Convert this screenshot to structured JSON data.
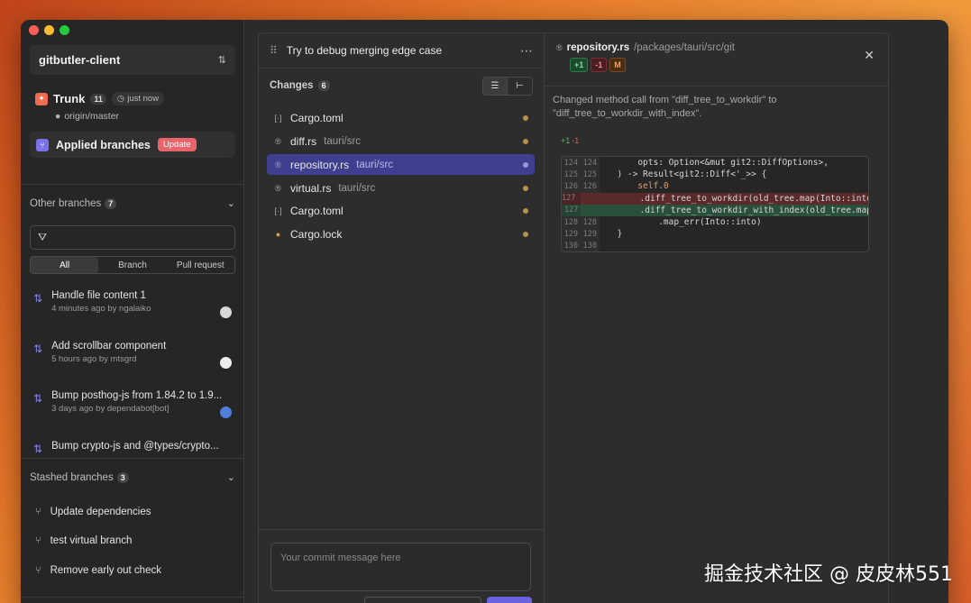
{
  "sidebar": {
    "project": "gitbutler-client",
    "trunk": {
      "title": "Trunk",
      "count": "11",
      "time": "just now",
      "remote": "origin/master"
    },
    "applied": {
      "title": "Applied branches",
      "badge": "Update"
    },
    "other": {
      "label": "Other branches",
      "count": "7",
      "filter_placeholder": "",
      "tabs": [
        "All",
        "Branch",
        "Pull request"
      ],
      "items": [
        {
          "title": "Handle file content 1",
          "meta": "4 minutes ago by ngalaiko"
        },
        {
          "title": "Add scrollbar component",
          "meta": "5 hours ago by mtsgrd"
        },
        {
          "title": "Bump posthog-js from 1.84.2 to 1.9...",
          "meta": "3 days ago by dependabot[bot]"
        },
        {
          "title": "Bump crypto-js and @types/crypto...",
          "meta": ""
        }
      ]
    },
    "stashed": {
      "label": "Stashed branches",
      "count": "3",
      "items": [
        "Update dependencies",
        "test virtual branch",
        "Remove early out check"
      ]
    }
  },
  "lane": {
    "title": "Try to debug merging edge case",
    "changes_label": "Changes",
    "changes_count": "6",
    "files": [
      {
        "icon": "[·]",
        "name": "Cargo.toml",
        "path": ""
      },
      {
        "icon": "®",
        "name": "diff.rs",
        "path": "tauri/src"
      },
      {
        "icon": "®",
        "name": "repository.rs",
        "path": "tauri/src"
      },
      {
        "icon": "®",
        "name": "virtual.rs",
        "path": "tauri/src"
      },
      {
        "icon": "[·]",
        "name": "Cargo.toml",
        "path": ""
      },
      {
        "icon": "●",
        "name": "Cargo.lock",
        "path": ""
      }
    ],
    "commit_placeholder": "Your commit message here"
  },
  "diff": {
    "file": "repository.rs",
    "path": "/packages/tauri/src/git",
    "tags": [
      "+1",
      "-1",
      "M"
    ],
    "message": "Changed method call from \"diff_tree_to_workdir\" to \"diff_tree_to_workdir_with_index\".",
    "hunk_add": "+1",
    "hunk_del": "-1",
    "lines": [
      {
        "old": "124",
        "new": "124",
        "type": "ctx",
        "text": "      opts: Option<&mut git2::DiffOptions>,"
      },
      {
        "old": "125",
        "new": "125",
        "type": "ctx",
        "text": "  ) -> Result<git2::Diff<'_>> {"
      },
      {
        "old": "126",
        "new": "126",
        "type": "ctx",
        "text": "      self.0"
      },
      {
        "old": "127",
        "new": "",
        "type": "del",
        "text": "          .diff_tree_to_workdir(old_tree.map(Into::into"
      },
      {
        "old": "",
        "new": "127",
        "type": "add",
        "text": "          .diff_tree_to_workdir_with_index(old_tree.map"
      },
      {
        "old": "128",
        "new": "128",
        "type": "ctx",
        "text": "          .map_err(Into::into)"
      },
      {
        "old": "129",
        "new": "129",
        "type": "ctx",
        "text": "  }"
      },
      {
        "old": "130",
        "new": "130",
        "type": "ctx",
        "text": ""
      }
    ]
  },
  "watermark": "掘金技术社区 @ 皮皮林551",
  "colors": {
    "accent": "#6b62e0",
    "selected": "#3e3f8f",
    "update_badge": "#e8636a"
  }
}
